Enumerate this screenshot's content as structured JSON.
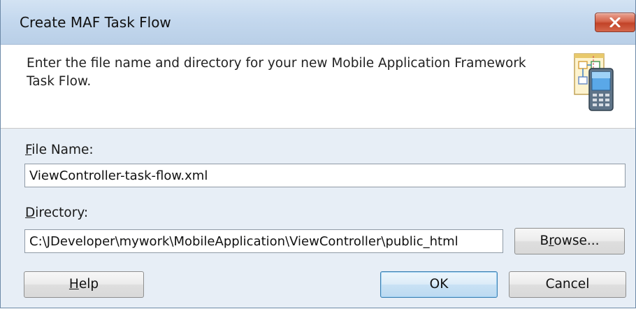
{
  "window": {
    "title": "Create MAF Task Flow"
  },
  "header": {
    "description": "Enter the file name and directory for your new Mobile Application Framework Task Flow.",
    "icon": "task-flow-mobile-icon"
  },
  "form": {
    "file_name": {
      "label_mnemonic": "F",
      "label_rest": "ile Name:",
      "value": "ViewController-task-flow.xml"
    },
    "directory": {
      "label_mnemonic": "D",
      "label_rest": "irectory:",
      "value": "C:\\JDeveloper\\mywork\\MobileApplication\\ViewController\\public_html"
    }
  },
  "buttons": {
    "browse": {
      "pre": "B",
      "mnemonic": "r",
      "post": "owse..."
    },
    "help": {
      "pre": "",
      "mnemonic": "H",
      "post": "elp"
    },
    "ok": "OK",
    "cancel": "Cancel"
  },
  "colors": {
    "title_bar": "#c4d8ee",
    "close_button": "#c74a30",
    "body_background": "#e7eef6",
    "default_button_border": "#3c7fb1"
  }
}
